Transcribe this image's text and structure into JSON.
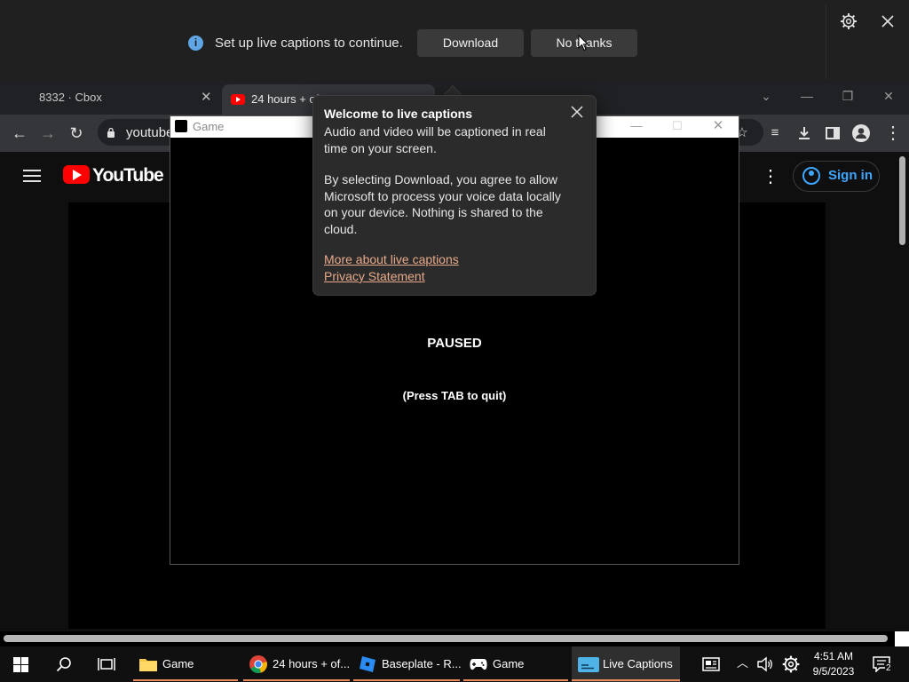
{
  "live_captions_bar": {
    "message": "Set up live captions to continue.",
    "download_label": "Download",
    "no_thanks_label": "No thanks"
  },
  "browser": {
    "tabs": [
      {
        "title": "8332 · Cbox",
        "active": false
      },
      {
        "title": "24 hours + of",
        "active": true
      }
    ],
    "url": "youtube"
  },
  "youtube": {
    "wordmark": "YouTube",
    "sign_in_label": "Sign in"
  },
  "game_window": {
    "title": "Game",
    "status": "PAUSED",
    "hint": "(Press TAB to quit)"
  },
  "welcome_flyout": {
    "title": "Welcome to live captions",
    "paragraph_1": "Audio and video will be captioned in real time on your screen.",
    "paragraph_2": "By selecting Download, you agree to allow Microsoft to process your voice data locally on your device. Nothing is shared to the cloud.",
    "link_more": "More about live captions",
    "link_privacy": "Privacy Statement"
  },
  "taskbar": {
    "apps": [
      {
        "label": "Game",
        "icon": "folder-icon"
      },
      {
        "label": "24 hours + of...",
        "icon": "chrome-icon"
      },
      {
        "label": "Baseplate - R...",
        "icon": "roblox-studio-icon"
      },
      {
        "label": "Game",
        "icon": "gamepad-icon"
      },
      {
        "label": "Live Captions",
        "icon": "live-captions-icon",
        "active": true
      }
    ],
    "time": "4:51 AM",
    "date": "9/5/2023",
    "notification_count": "2"
  },
  "colors": {
    "accent_link": "#e8a98a",
    "taskbar_underline": "#e98a5a",
    "youtube_red": "#ff0000",
    "signin_blue": "#3ea6ff"
  }
}
